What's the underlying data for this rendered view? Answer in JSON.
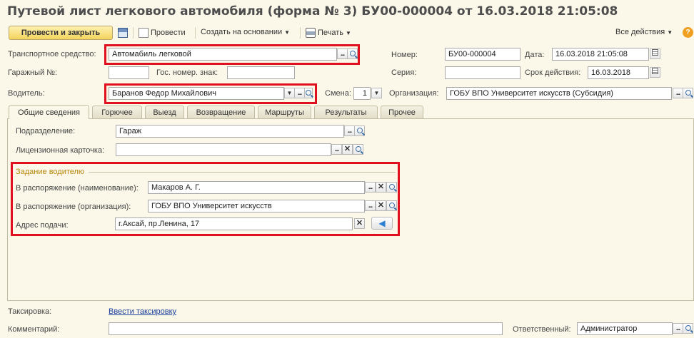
{
  "window": {
    "title": "Путевой лист легкового автомобиля (форма № 3) БУ00-000004 от 16.03.2018 21:05:08"
  },
  "toolbar": {
    "post_close_label": "Провести и закрыть",
    "post_label": "Провести",
    "create_based_label": "Создать на основании",
    "print_label": "Печать",
    "all_actions_label": "Все действия",
    "help_label": "?"
  },
  "header": {
    "vehicle_label": "Транспортное средство:",
    "vehicle_value": "Автомабиль легковой",
    "garage_label": "Гаражный №:",
    "garage_value": "",
    "plate_label": "Гос. номер. знак:",
    "plate_value": "",
    "driver_label": "Водитель:",
    "driver_value": "Баранов Федор Михайлович",
    "shift_label": "Смена:",
    "shift_value": "1",
    "number_label": "Номер:",
    "number_value": "БУ00-000004",
    "date_label": "Дата:",
    "date_value": "16.03.2018 21:05:08",
    "series_label": "Серия:",
    "series_value": "",
    "valid_label": "Срок действия:",
    "valid_value": "16.03.2018",
    "org_label": "Организация:",
    "org_value": "ГОБУ ВПО Университет искусств (Субсидия)"
  },
  "tabs": [
    {
      "label": "Общие сведения"
    },
    {
      "label": "Горючее"
    },
    {
      "label": "Выезд"
    },
    {
      "label": "Возвращение"
    },
    {
      "label": "Маршруты"
    },
    {
      "label": "Результаты"
    },
    {
      "label": "Прочее"
    }
  ],
  "general": {
    "division_label": "Подразделение:",
    "division_value": "Гараж",
    "license_label": "Лицензионная карточка:",
    "license_value": "",
    "task_group_label": "Задание водителю",
    "disposal_name_label": "В распоряжение (наименование):",
    "disposal_name_value": "Макаров А. Г.",
    "disposal_org_label": "В распоряжение (организация):",
    "disposal_org_value": "ГОБУ ВПО Университет искусств",
    "address_label": "Адрес подачи:",
    "address_value": "г.Аксай, пр.Ленина, 17"
  },
  "footer": {
    "taxing_label": "Таксировка:",
    "taxing_link": "Ввести таксировку",
    "comment_label": "Комментарий:",
    "comment_value": "",
    "responsible_label": "Ответственный:",
    "responsible_value": "Администратор"
  },
  "colors": {
    "highlight": "#e0101f",
    "background": "#fbf8ea",
    "primary_button": "#f2d45c"
  }
}
